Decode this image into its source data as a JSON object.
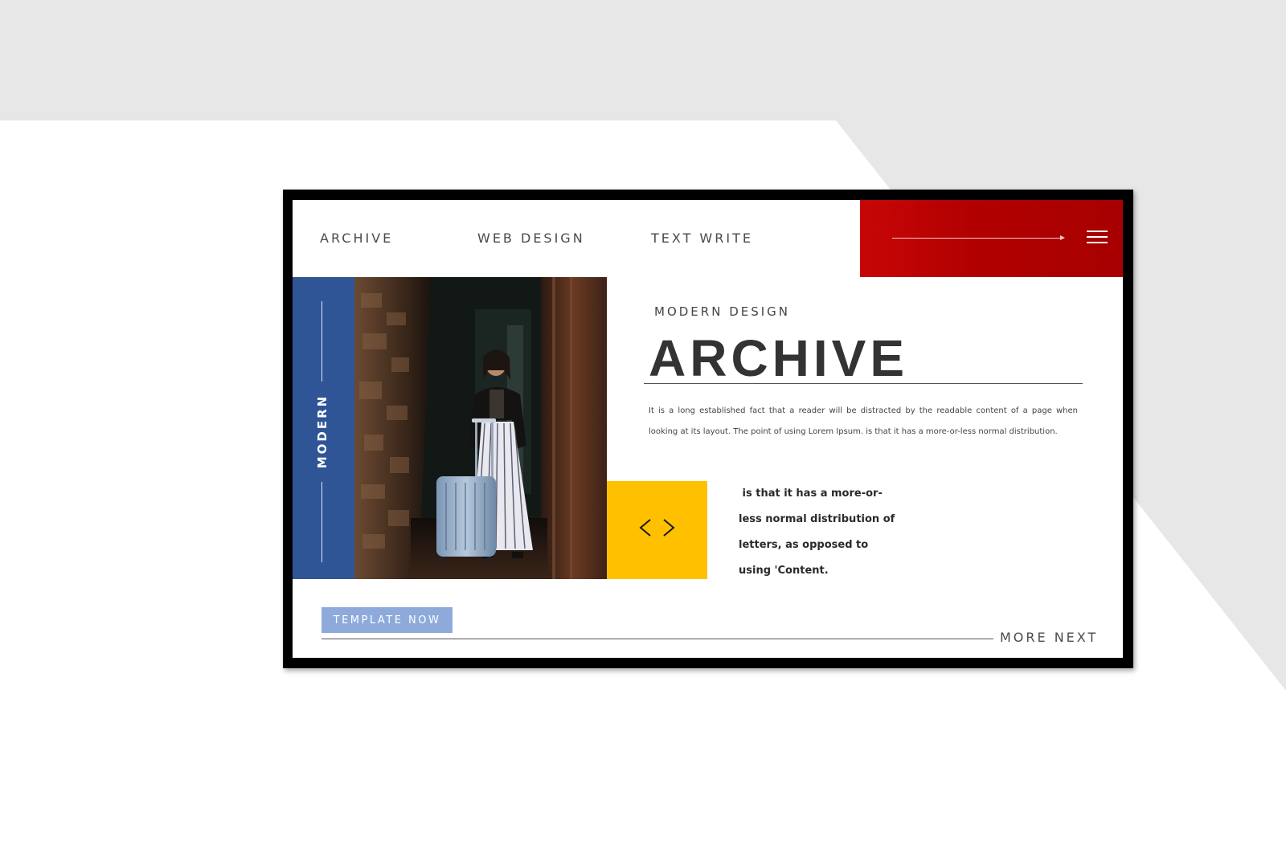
{
  "nav": {
    "items": [
      {
        "label": "ARCHIVE"
      },
      {
        "label": "WEB DESIGN"
      },
      {
        "label": "TEXT WRITE"
      }
    ],
    "menu_icon": "hamburger-menu-icon",
    "arrow_icon": "arrow-right-icon"
  },
  "sidebar": {
    "vertical_label": "MODERN"
  },
  "hero": {
    "eyebrow": "MODERN DESIGN",
    "title": "ARCHIVE",
    "paragraph": "It is a long established fact that a reader will be distracted by the readable content of a page when looking at its layout. The point of using Lorem Ipsum.  is that it has a more-or-less normal distribution.",
    "quote_lines": [
      " is that it has a more-or-",
      "less normal distribution of",
      "letters, as opposed to",
      "using 'Content."
    ]
  },
  "code_box": {
    "icon": "code-brackets-icon"
  },
  "footer": {
    "cta_label": "TEMPLATE NOW",
    "more_label": "MORE NEXT"
  },
  "colors": {
    "red": "#b10000",
    "blue": "#2f5597",
    "yellow": "#ffc000",
    "cta": "#8eaadb",
    "title": "#333333"
  }
}
